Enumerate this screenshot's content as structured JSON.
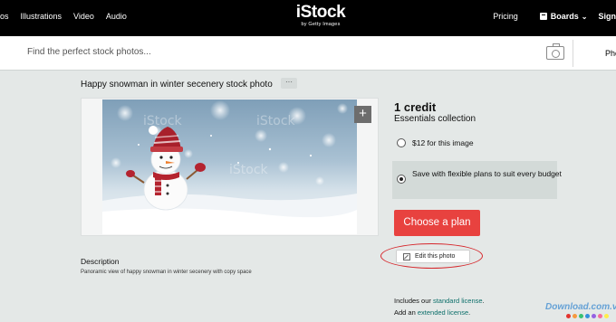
{
  "nav": {
    "left_items": [
      "os",
      "Illustrations",
      "Video",
      "Audio"
    ],
    "logo": "iStock",
    "logo_sub": "by Getty Images",
    "pricing": "Pricing",
    "boards": "Boards",
    "sign": "Sign"
  },
  "search": {
    "placeholder": "Find the perfect stock photos...",
    "tab": "Pho"
  },
  "asset": {
    "title": "Happy snowman in winter secenery stock photo",
    "more": "···",
    "image_watermark": "iStock",
    "plus": "+",
    "description_heading": "Description",
    "description": "Panoramic view of happy snowman in winter secenery with copy space"
  },
  "pricing_panel": {
    "credit": "1 credit",
    "collection": "Essentials collection",
    "option1": "$12 for this image",
    "option2": "Save with flexible plans to suit every budget",
    "cta": "Choose a plan",
    "edit": "Edit this photo",
    "includes_prefix": "Includes our ",
    "includes_link": "standard license",
    "includes_suffix": ".",
    "add_prefix": "Add an ",
    "add_link": "extended license",
    "add_suffix": "."
  },
  "watermark": {
    "text": "Download.com.vn",
    "dot_colors": [
      "#e3342f",
      "#f6993f",
      "#38c172",
      "#3490dc",
      "#9561e2",
      "#f66d9b",
      "#ffed4a"
    ]
  },
  "colors": {
    "topbar": "#000000",
    "cta": "#e8423f",
    "link": "#0c6f6a",
    "highlight_ring": "#d6252a"
  }
}
